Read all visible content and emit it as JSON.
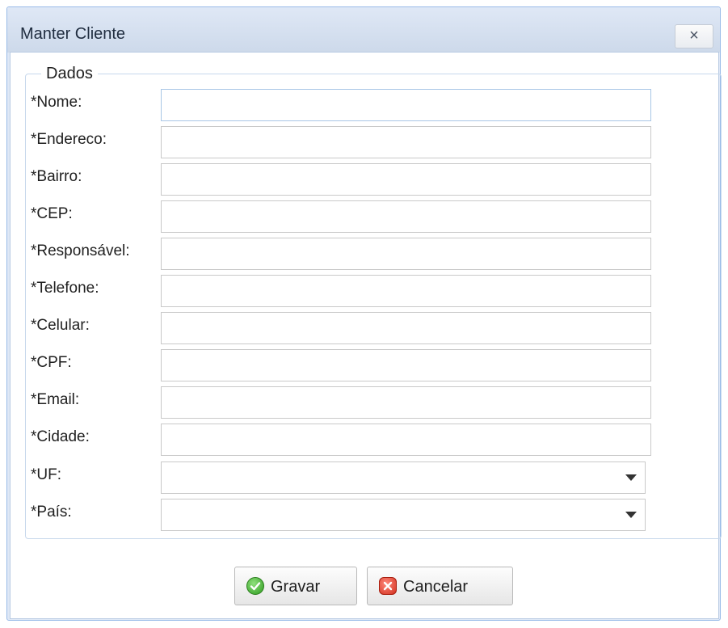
{
  "window": {
    "title": "Manter Cliente",
    "close_symbol": "×"
  },
  "form": {
    "legend": "Dados",
    "fields": [
      {
        "label": "*Nome:",
        "value": ""
      },
      {
        "label": "*Endereco:",
        "value": ""
      },
      {
        "label": "*Bairro:",
        "value": ""
      },
      {
        "label": "*CEP:",
        "value": ""
      },
      {
        "label": "*Responsável:",
        "value": ""
      },
      {
        "label": "*Telefone:",
        "value": ""
      },
      {
        "label": "*Celular:",
        "value": ""
      },
      {
        "label": "*CPF:",
        "value": ""
      },
      {
        "label": "*Email:",
        "value": ""
      },
      {
        "label": "*Cidade:",
        "value": ""
      }
    ],
    "selects": [
      {
        "label": "*UF:",
        "value": ""
      },
      {
        "label": "*País:",
        "value": ""
      }
    ]
  },
  "buttons": {
    "save_label": "Gravar",
    "cancel_label": "Cancelar"
  },
  "icons": {
    "save": "check-circle-icon",
    "cancel": "x-square-icon",
    "close": "close-icon",
    "dropdown": "chevron-down-icon"
  }
}
